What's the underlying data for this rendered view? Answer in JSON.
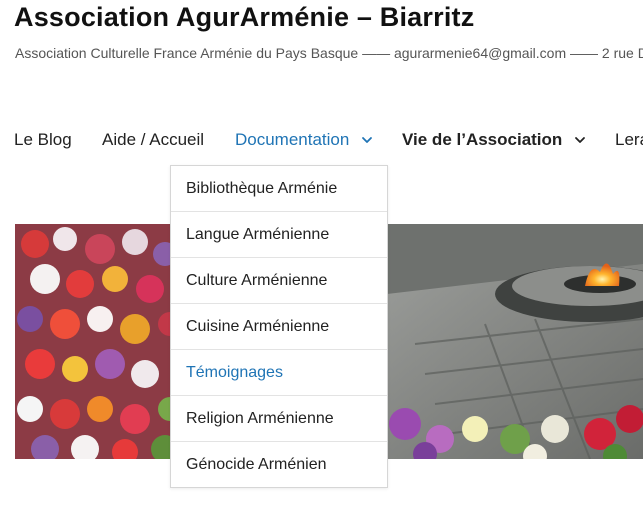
{
  "site": {
    "title": "Association AgurArménie – Biarritz",
    "tagline": "Association Culturelle France Arménie du Pays Basque —— agurarmenie64@gmail.com —— 2 rue D"
  },
  "nav": {
    "items": [
      {
        "label": "Le Blog"
      },
      {
        "label": "Aide / Accueil"
      },
      {
        "label": "Documentation"
      },
      {
        "label": "Vie de l’Association"
      },
      {
        "label": "Lera"
      }
    ]
  },
  "dropdown": {
    "items": [
      {
        "label": "Bibliothèque Arménie"
      },
      {
        "label": "Langue Arménienne"
      },
      {
        "label": "Culture Arménienne"
      },
      {
        "label": "Cuisine Arménienne"
      },
      {
        "label": "Témoignages"
      },
      {
        "label": "Religion Arménienne"
      },
      {
        "label": "Génocide Arménien"
      }
    ]
  },
  "colors": {
    "accent": "#1f74b5",
    "text": "#222222"
  },
  "icons": [
    "chevron-down-icon"
  ]
}
